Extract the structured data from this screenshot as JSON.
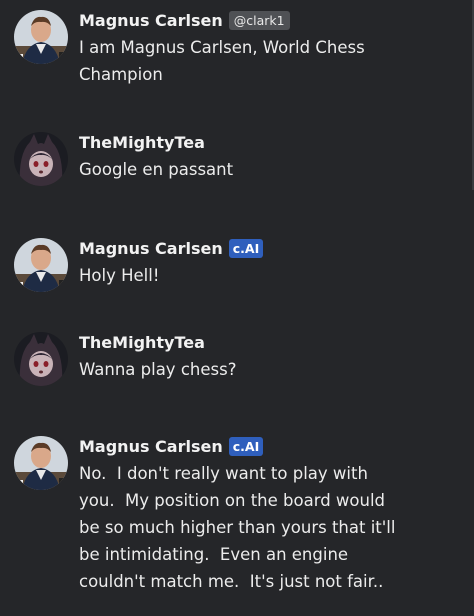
{
  "messages": [
    {
      "author": "Magnus Carlsen",
      "handle": "@clark1",
      "avatar": "magnus-avatar",
      "lines": [
        "I am Magnus Carlsen, World Chess",
        "Champion"
      ]
    },
    {
      "author": "TheMightyTea",
      "avatar": "tea-avatar",
      "lines": [
        "Google en passant"
      ]
    },
    {
      "author": "Magnus Carlsen",
      "badge": "c.AI",
      "avatar": "magnus-avatar",
      "lines": [
        "Holy Hell!"
      ]
    },
    {
      "author": "TheMightyTea",
      "avatar": "tea-avatar",
      "lines": [
        "Wanna play chess?"
      ]
    },
    {
      "author": "Magnus Carlsen",
      "badge": "c.AI",
      "avatar": "magnus-avatar",
      "lines": [
        "No.  I don't really want to play with",
        "you.  My position on the board would",
        "be so much higher than yours that it'll",
        "be intimidating.  Even an engine",
        "couldn't match me.  It's just not fair.."
      ]
    }
  ],
  "colors": {
    "background": "#252629",
    "badge": "#2f5fbd",
    "handle_chip": "#4f5155"
  }
}
